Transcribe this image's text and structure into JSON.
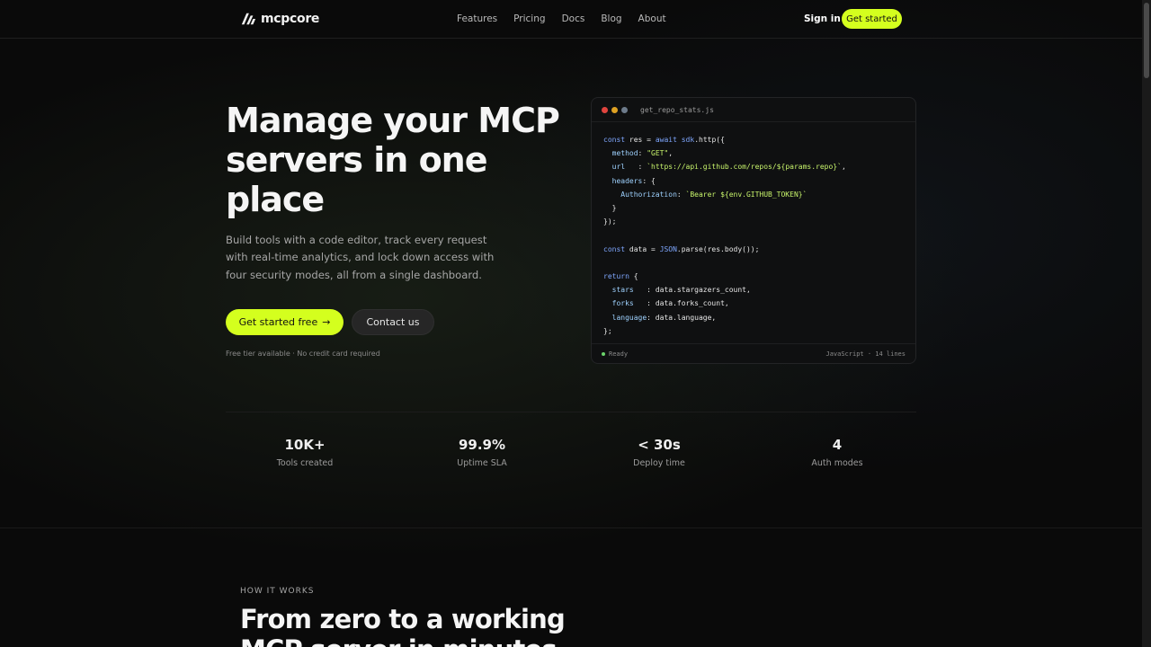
{
  "header": {
    "logo_text": "mcpcore",
    "nav": [
      "Features",
      "Pricing",
      "Docs",
      "Blog",
      "About"
    ],
    "signin": "Sign in",
    "cta": "Get started"
  },
  "hero": {
    "title": "Manage your MCP servers in one place",
    "subtitle": "Build tools with a code editor, track every request with real-time analytics, and lock down access with four security modes, all from a single dashboard.",
    "primary_button": "Get started free",
    "secondary_button": "Contact us",
    "fineprint": "Free tier available · No credit card required"
  },
  "code_window": {
    "filename": "get_repo_stats.js",
    "dot_colors": [
      "#e0443e",
      "#dea123",
      "#6d7b8b"
    ],
    "status": "Ready",
    "language_info": "JavaScript · 14 lines",
    "lines": [
      "const res = await sdk.http({",
      "  method: \"GET\",",
      "  url   : `https://api.github.com/repos/${params.repo}`,",
      "  headers: {",
      "    Authorization: `Bearer ${env.GITHUB_TOKEN}`",
      "  }",
      "});",
      "",
      "const data = JSON.parse(res.body());",
      "",
      "return {",
      "  stars   : data.stargazers_count,",
      "  forks   : data.forks_count,",
      "  language: data.language,",
      "};"
    ]
  },
  "stats": [
    {
      "value": "10K+",
      "label": "Tools created"
    },
    {
      "value": "99.9%",
      "label": "Uptime SLA"
    },
    {
      "value": "< 30s",
      "label": "Deploy time"
    },
    {
      "value": "4",
      "label": "Auth modes"
    }
  ],
  "how_it_works": {
    "label": "HOW IT WORKS",
    "title": "From zero to a working MCP server in minutes"
  },
  "colors": {
    "accent": "#d4ff1e",
    "background": "#0a0a0a"
  }
}
